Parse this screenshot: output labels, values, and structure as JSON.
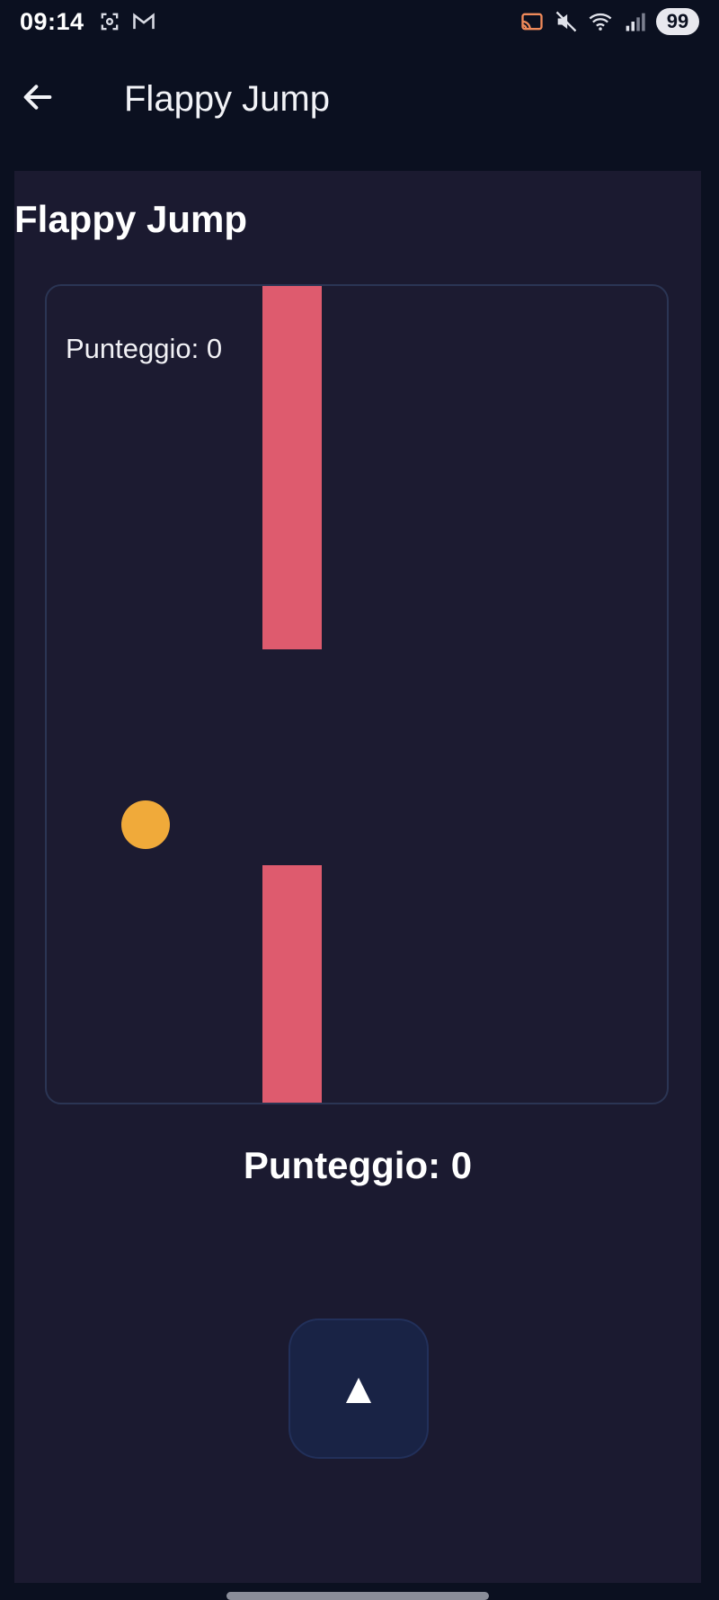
{
  "status_bar": {
    "time": "09:14",
    "battery": "99",
    "left_icons": [
      "screenshot-icon",
      "gmail-icon"
    ],
    "right_icons": [
      "cast-icon",
      "mute-icon",
      "wifi-icon",
      "signal-icon"
    ]
  },
  "app_bar": {
    "title": "Flappy Jump",
    "back_icon": "arrow-left-icon"
  },
  "page": {
    "heading": "Flappy Jump",
    "game": {
      "overlay_score": "Punteggio: 0",
      "colors": {
        "pipe": "#de5b6e",
        "bird": "#f0aa3a",
        "border": "#2b3554",
        "background": "#1c1b31"
      }
    },
    "score": "Punteggio: 0",
    "jump_button": {
      "label": "▲"
    }
  }
}
